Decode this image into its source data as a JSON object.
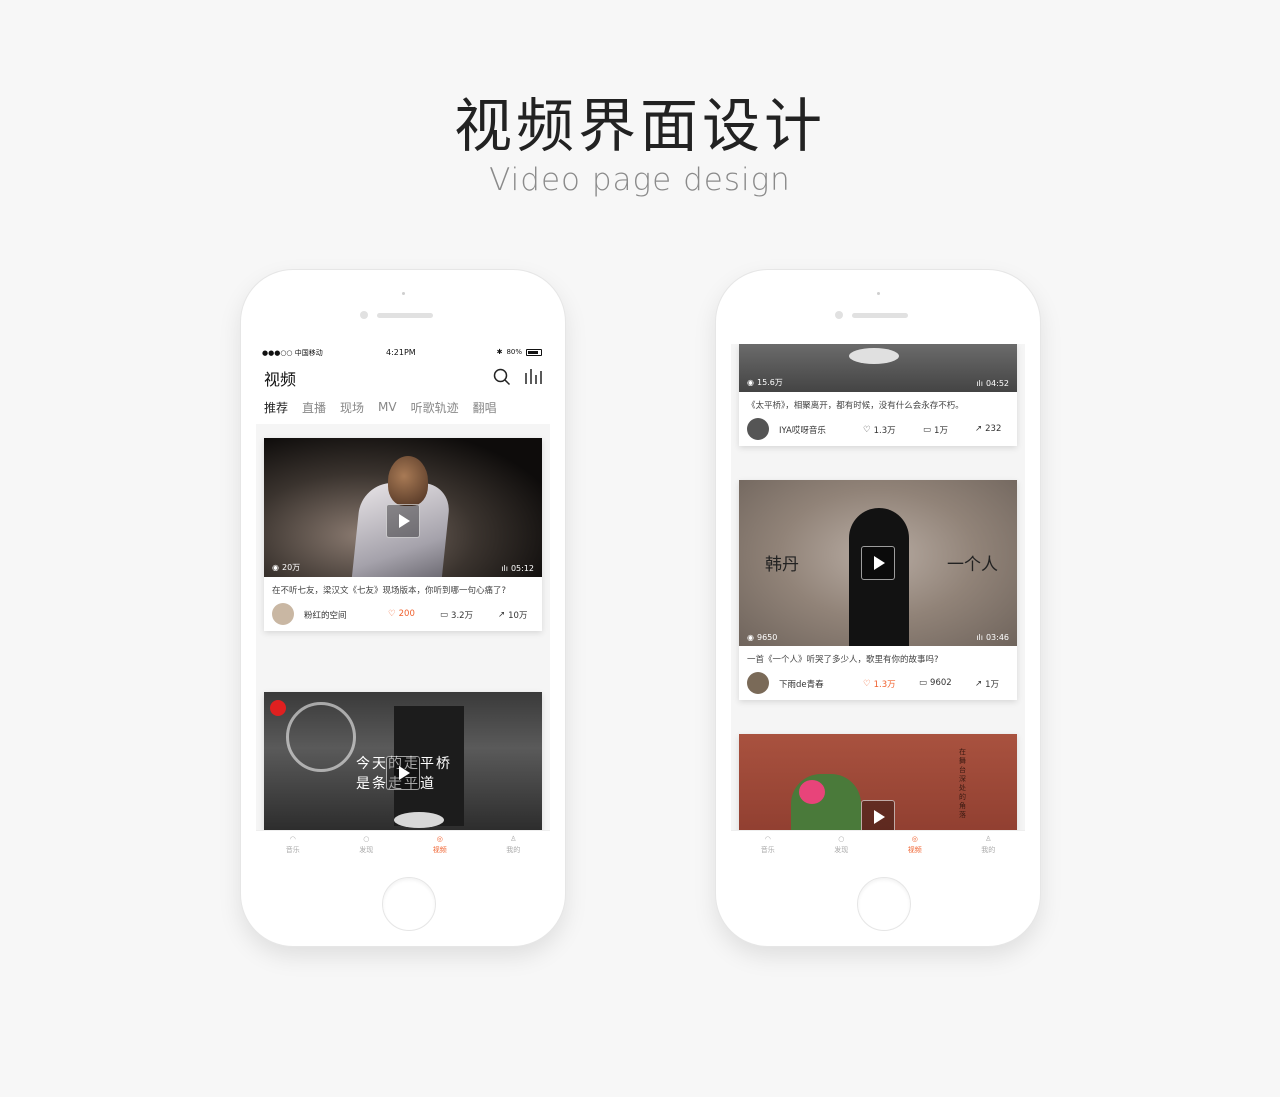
{
  "header": {
    "title": "视频界面设计",
    "subtitle": "Video page design"
  },
  "colors": {
    "accent": "#f0622f",
    "background": "#f7f7f7"
  },
  "left": {
    "status": {
      "carrier": "●●●○○ 中国移动",
      "time": "4:21PM",
      "battery": "80%"
    },
    "page_title": "视频",
    "tabs": [
      "推荐",
      "直播",
      "现场",
      "MV",
      "听歌轨迹",
      "翻唱"
    ],
    "cards": [
      {
        "views": "20万",
        "duration": "05:12",
        "desc": "在不听七友，梁汉文《七友》现场版本，你听到哪一句心痛了?",
        "author": "粉红的空间",
        "likes": "200",
        "comments": "3.2万",
        "shares": "10万"
      },
      {
        "overlay_line1": "今天的走平桥",
        "overlay_line2": "是条走平道"
      }
    ],
    "tabbar": [
      "音乐",
      "发现",
      "视频",
      "我的"
    ]
  },
  "right": {
    "cards": [
      {
        "views": "15.6万",
        "duration": "04:52",
        "desc": "《太平桥》，相聚离开，都有时候，没有什么会永存不朽。",
        "author": "IYA哎呀音乐",
        "likes": "1.3万",
        "comments": "1万",
        "shares": "232"
      },
      {
        "overlay_left": "韩丹",
        "overlay_right": "一个人",
        "views": "9650",
        "duration": "03:46",
        "desc": "一首《一个人》听哭了多少人，歌里有你的故事吗?",
        "author": "下雨de青春",
        "likes": "1.3万",
        "comments": "9602",
        "shares": "1万"
      },
      {
        "vertical_text": "在舞台深处的角落"
      }
    ],
    "tabbar": [
      "音乐",
      "发现",
      "视频",
      "我的"
    ]
  }
}
